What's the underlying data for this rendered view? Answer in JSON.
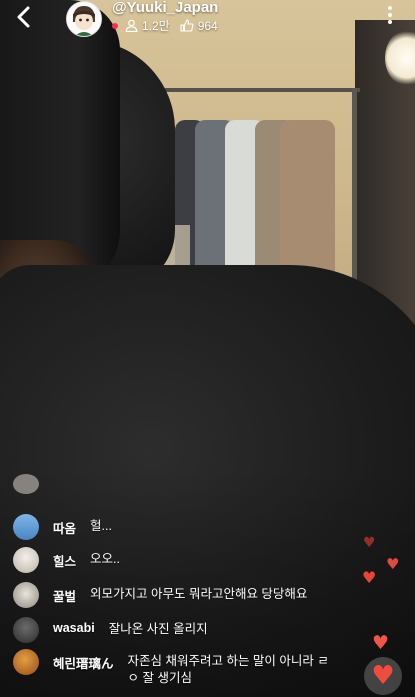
{
  "header": {
    "username": "@Yuuki_Japan",
    "viewers": "1.2만",
    "likes": "964"
  },
  "comments": [
    {
      "user": "",
      "text": "",
      "faded": true
    },
    {
      "user": "따옴",
      "text": "헐..."
    },
    {
      "user": "힐스",
      "text": "오오.."
    },
    {
      "user": "꿀벌",
      "text": "외모가지고 아무도 뭐라고안해요 당당해요"
    },
    {
      "user": "wasabi",
      "text": "잘나온 사진 올리지"
    },
    {
      "user": "혜린瑨璃ん",
      "text": "자존심 채워주려고 하는 말이 아니라 ㄹㅇ 잘 생기심"
    }
  ],
  "colors": {
    "heart": "#e8443a",
    "live_dot": "#ff2d55"
  },
  "icons": [
    "back-chevron-icon",
    "viewers-icon",
    "likes-icon",
    "more-vertical-icon",
    "heart-icon"
  ]
}
